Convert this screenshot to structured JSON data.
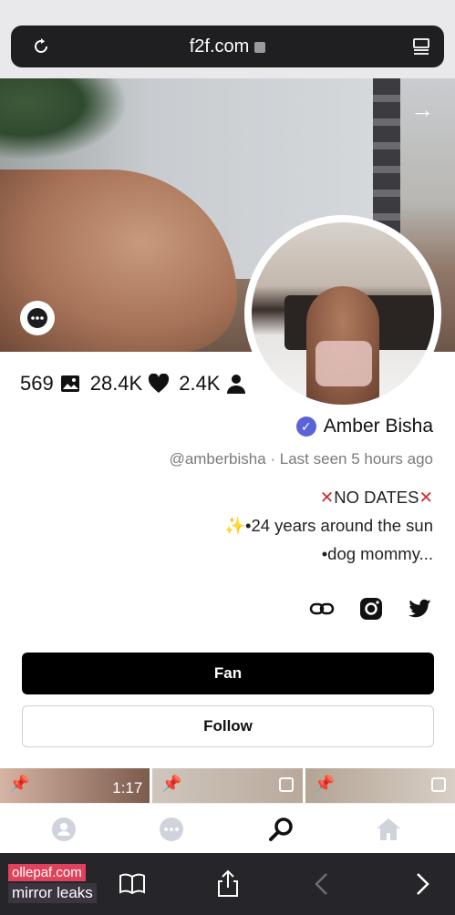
{
  "browser": {
    "url": "f2f.com"
  },
  "profile": {
    "stats": {
      "media": "569",
      "likes": "28.4K",
      "fans": "2.4K"
    },
    "name": "Amber Bisha",
    "verified": true,
    "handle_line": "@amberbisha · Last seen 5 hours ago",
    "bio": {
      "line1": "NO DATES",
      "line2": "•24 years around the sun",
      "line3": "•dog mommy..."
    },
    "socials": [
      "twitter-icon",
      "instagram-icon",
      "link-icon"
    ]
  },
  "buttons": {
    "fan": "Fan",
    "follow": "Follow"
  },
  "thumbnails": [
    {
      "pinned": true,
      "duration": "1:17"
    },
    {
      "pinned": true,
      "multi": true
    },
    {
      "pinned": true,
      "multi": true
    }
  ],
  "nav": [
    "home-icon",
    "search-icon",
    "messages-icon",
    "profile-icon"
  ],
  "watermark": {
    "line1": "ollepaf.com",
    "line2": "mirror leaks"
  },
  "colors": {
    "verified": "#5b63d8",
    "pin": "#e2467a",
    "x_mark": "#d32a2a"
  }
}
